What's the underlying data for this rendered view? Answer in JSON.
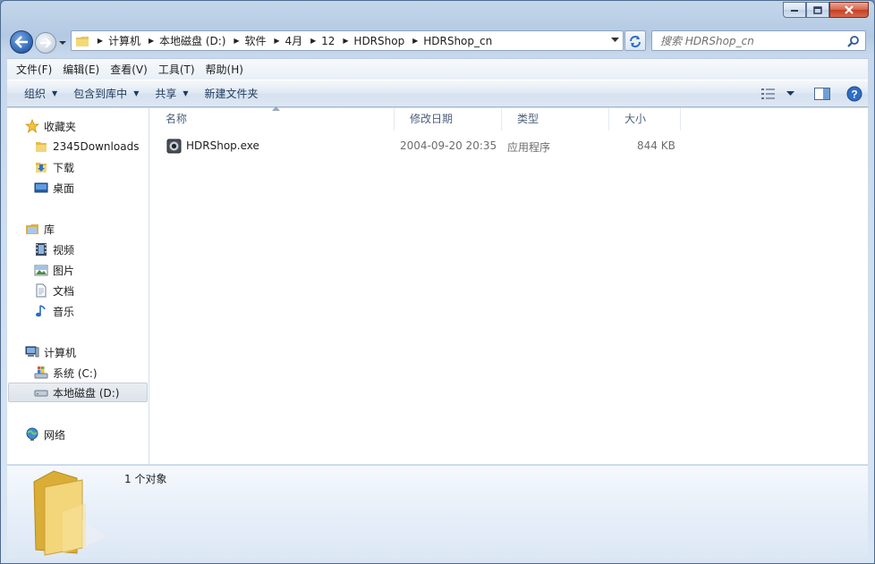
{
  "window": {
    "caption": {
      "minimize": "minimize",
      "maximize": "maximize",
      "close": "close"
    }
  },
  "address_bar": {
    "breadcrumbs": [
      "计算机",
      "本地磁盘 (D:)",
      "软件",
      "4月",
      "12",
      "HDRShop",
      "HDRShop_cn"
    ]
  },
  "search": {
    "placeholder": "搜索 HDRShop_cn"
  },
  "menubar": {
    "items": [
      "文件(F)",
      "编辑(E)",
      "查看(V)",
      "工具(T)",
      "帮助(H)"
    ]
  },
  "commandbar": {
    "organize": "组织",
    "include_in_library": "包含到库中",
    "share": "共享",
    "new_folder": "新建文件夹"
  },
  "nav_pane": {
    "favorites": {
      "label": "收藏夹",
      "items": [
        "2345Downloads",
        "下载",
        "桌面"
      ]
    },
    "libraries": {
      "label": "库",
      "items": [
        "视频",
        "图片",
        "文档",
        "音乐"
      ]
    },
    "computer": {
      "label": "计算机",
      "items": [
        "系统 (C:)",
        "本地磁盘 (D:)"
      ]
    },
    "network": {
      "label": "网络"
    }
  },
  "file_list": {
    "columns": [
      "名称",
      "修改日期",
      "类型",
      "大小"
    ],
    "rows": [
      {
        "name": "HDRShop.exe",
        "modified": "2004-09-20 20:35",
        "type": "应用程序",
        "size": "844 KB"
      }
    ]
  },
  "details_pane": {
    "summary": "1 个对象"
  },
  "colors": {
    "window_frame": "#c4d6ea",
    "selected_nav": "#dde3ea",
    "header_text": "#4c607a",
    "details_bg": "#e6eef8"
  }
}
